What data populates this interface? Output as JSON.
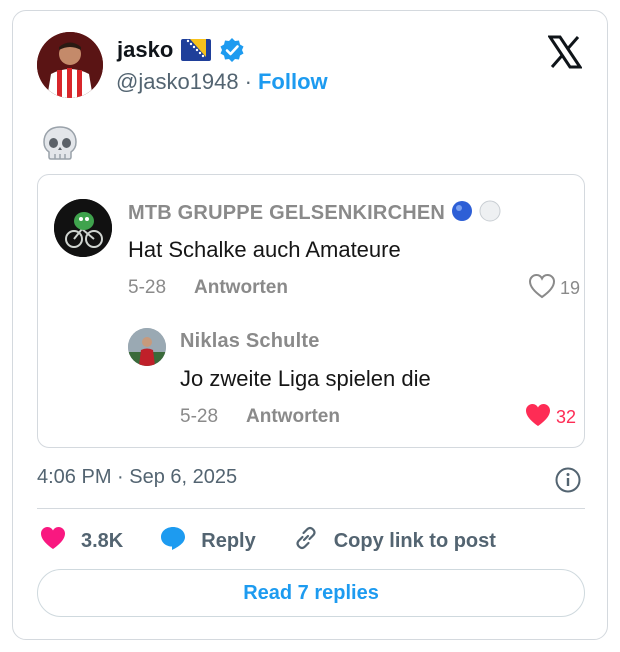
{
  "author": {
    "name": "jasko",
    "handle": "@jasko1948",
    "separator": "·",
    "follow_label": "Follow"
  },
  "post": {
    "emoji_icon": "skull-icon",
    "timestamp": "4:06 PM · Sep 6, 2025"
  },
  "quoted_comments": [
    {
      "name": "MTB GRUPPE GELSENKIRCHEN",
      "text": "Hat Schalke auch Amateure",
      "date": "5-28",
      "reply_label": "Antworten",
      "likes": "19",
      "liked": false
    },
    {
      "name": "Niklas Schulte",
      "text": "Jo zweite Liga spielen die",
      "date": "5-28",
      "reply_label": "Antworten",
      "likes": "32",
      "liked": true
    }
  ],
  "actions": {
    "like_count": "3.8K",
    "reply_label": "Reply",
    "copy_label": "Copy link to post"
  },
  "read_replies_label": "Read 7 replies",
  "colors": {
    "accent": "#1d9bf0",
    "like_pink": "#f91880",
    "tiktok_red": "#fe2c55",
    "muted": "#536471"
  }
}
